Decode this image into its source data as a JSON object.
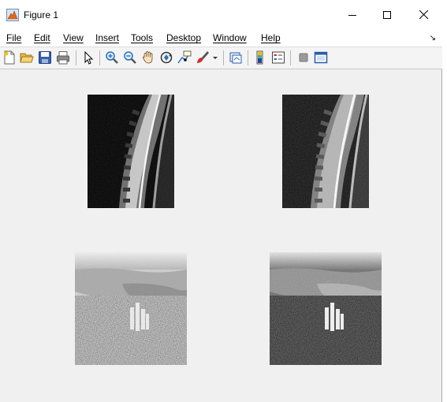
{
  "window": {
    "title": "Figure 1",
    "controls": [
      "minimize",
      "maximize",
      "close"
    ]
  },
  "menu": {
    "items": [
      {
        "label": "File"
      },
      {
        "label": "Edit"
      },
      {
        "label": "View"
      },
      {
        "label": "Insert"
      },
      {
        "label": "Tools"
      },
      {
        "label": "Desktop"
      },
      {
        "label": "Window"
      },
      {
        "label": "Help"
      }
    ],
    "dock_icon": "↘"
  },
  "toolbar": {
    "buttons": [
      "new-figure-icon",
      "open-file-icon",
      "save-icon",
      "print-icon",
      "edit-plot-arrow-icon",
      "zoom-in-icon",
      "zoom-out-icon",
      "pan-hand-icon",
      "rotate-3d-icon",
      "data-cursor-icon",
      "brush-icon",
      "brush-dropdown-icon",
      "link-plot-icon",
      "insert-colorbar-icon",
      "insert-legend-icon",
      "hide-plot-tools-icon",
      "show-plot-tools-icon"
    ]
  },
  "figure": {
    "panels": [
      {
        "name": "mri-spine-original",
        "content": "grayscale sagittal spine MRI"
      },
      {
        "name": "mri-spine-equalized",
        "content": "grayscale sagittal spine MRI, enhanced"
      },
      {
        "name": "aerial-city-original",
        "content": "grayscale aerial photo of city and bay"
      },
      {
        "name": "aerial-city-equalized",
        "content": "grayscale aerial photo of city and bay, enhanced contrast"
      }
    ]
  },
  "colors": {
    "figure_background": "#f0f0f0",
    "titlebar": "#ffffff"
  }
}
